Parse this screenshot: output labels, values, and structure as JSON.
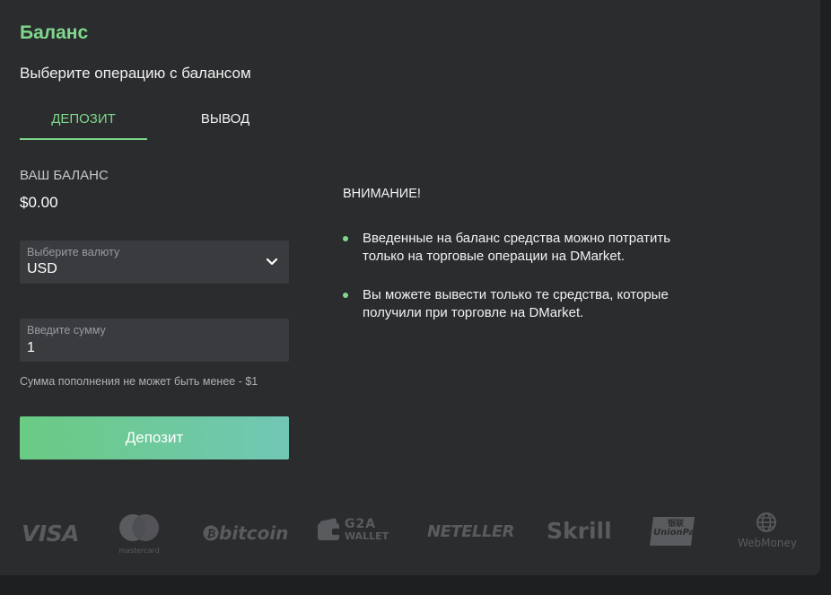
{
  "page": {
    "title": "Баланс",
    "subtitle": "Выберите операцию с балансом"
  },
  "tabs": [
    {
      "label": "ДЕПОЗИТ",
      "active": true
    },
    {
      "label": "ВЫВОД",
      "active": false
    }
  ],
  "balance": {
    "label": "ВАШ БАЛАНС",
    "value": "$0.00"
  },
  "currency_field": {
    "label": "Выберите валюту",
    "value": "USD"
  },
  "amount_field": {
    "label": "Введите сумму",
    "value": "1"
  },
  "hint": "Сумма пополнения не может быть менее - $1",
  "deposit_button": {
    "label": "Депозит"
  },
  "notice": {
    "title": "ВНИМАНИЕ!",
    "items": [
      "Введенные на баланс средства можно потратить только на торговые операции на DMarket.",
      "Вы можете вывести только те средства, которые получили при торговле на DMarket."
    ]
  },
  "payment_logos": {
    "visa": "VISA",
    "mastercard": "mastercard",
    "bitcoin": "bitcoin",
    "g2a_top": "G2A",
    "g2a_bottom": "WALLET",
    "neteller": "NETELLER",
    "skrill": "Skrill",
    "unionpay": "UnionPay",
    "unionpay_cn": "银联",
    "webmoney": "WebMoney"
  },
  "colors": {
    "accent": "#7fd88c",
    "panel_bg": "#2b2c2e",
    "field_bg": "#3a3b3e",
    "button_gradient_start": "#6acb83",
    "button_gradient_end": "#71c7b5",
    "logo_gray": "#5a5b5e"
  },
  "icons": {
    "dropdown": "chevron-down-icon"
  }
}
